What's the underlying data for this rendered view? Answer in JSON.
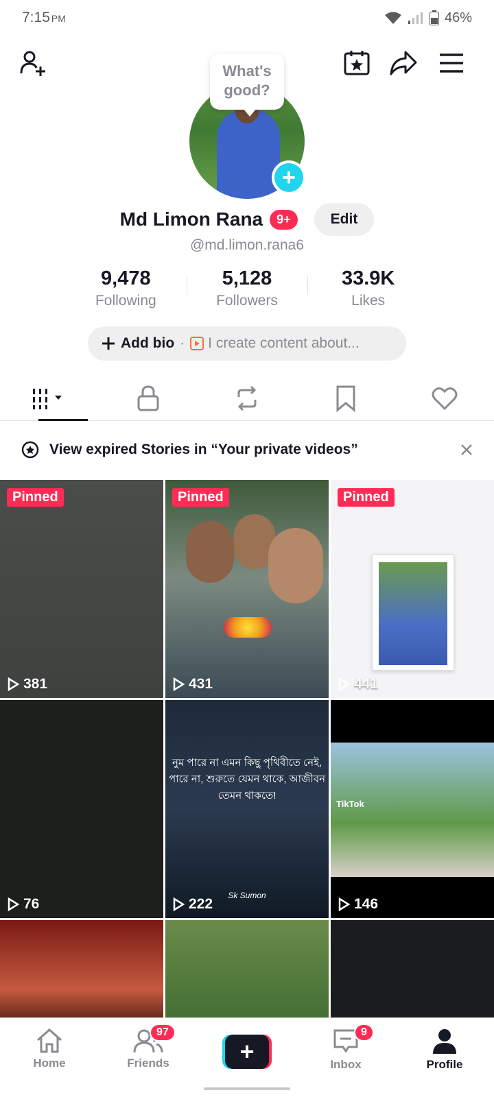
{
  "status": {
    "time": "7:15",
    "ampm": "PM",
    "battery": "46%"
  },
  "profile": {
    "bubble": "What's good?",
    "name": "Md Limon Rana",
    "badge": "9+",
    "edit_label": "Edit",
    "handle": "@md.limon.rana6",
    "stats": [
      {
        "value": "9,478",
        "label": "Following"
      },
      {
        "value": "5,128",
        "label": "Followers"
      },
      {
        "value": "33.9K",
        "label": "Likes"
      }
    ],
    "bio_add": "Add bio",
    "bio_hint": "I create content about..."
  },
  "stories_banner": "View expired Stories in “Your private videos”",
  "pinned_label": "Pinned",
  "videos": [
    {
      "views": "381",
      "pinned": true
    },
    {
      "views": "431",
      "pinned": true
    },
    {
      "views": "441",
      "pinned": true
    },
    {
      "views": "76",
      "pinned": false
    },
    {
      "views": "222",
      "pinned": false
    },
    {
      "views": "146",
      "pinned": false
    }
  ],
  "video_caption": "নুম পারে না এমন কিছু পৃথিবীতে নেই, পারে না, শুরুতে যেমন থাকে, আজীবন তেমন থাকতে!",
  "video_watermark": "Sk Sumon",
  "tiktok_label": "TikTok",
  "nav": [
    {
      "label": "Home",
      "icon": "home-icon"
    },
    {
      "label": "Friends",
      "icon": "friends-icon",
      "badge": "97"
    },
    {
      "label": "",
      "icon": "create-icon"
    },
    {
      "label": "Inbox",
      "icon": "inbox-icon",
      "badge": "9"
    },
    {
      "label": "Profile",
      "icon": "profile-icon"
    }
  ],
  "colors": {
    "accent": "#fe2c55",
    "teal": "#20d5ec",
    "text": "#161823",
    "muted": "#8a8b91"
  }
}
